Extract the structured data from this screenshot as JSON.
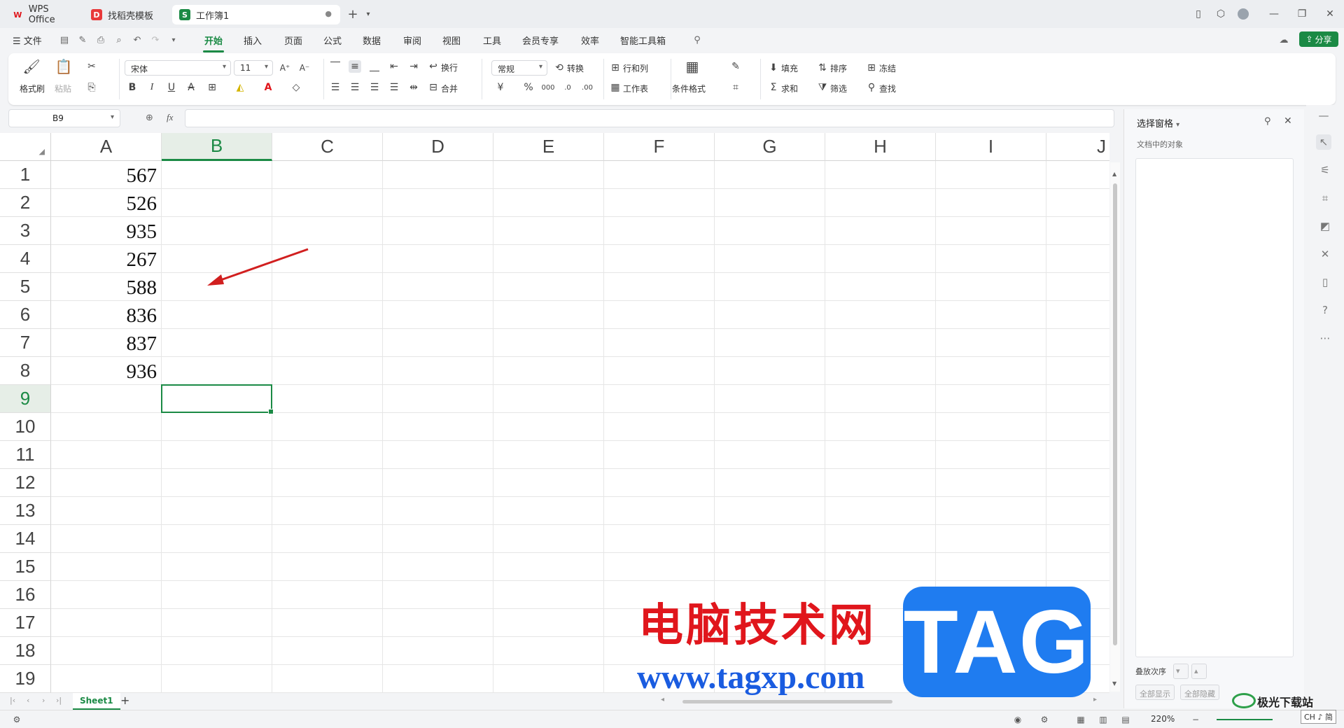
{
  "titlebar": {
    "tabs": [
      {
        "label": "WPS Office",
        "icon": "wps-logo-icon",
        "color": "#e0161c"
      },
      {
        "label": "找稻壳模板",
        "icon": "docer-icon",
        "color": "#e8393a"
      },
      {
        "label": "工作簿1",
        "icon": "spreadsheet-icon",
        "color": "#1b8a45"
      }
    ],
    "new_tab": "+"
  },
  "menubar": {
    "file": "文件",
    "items": [
      "开始",
      "插入",
      "页面",
      "公式",
      "数据",
      "审阅",
      "视图",
      "工具",
      "会员专享",
      "效率",
      "智能工具箱"
    ],
    "active": "开始",
    "share": "分享"
  },
  "ribbon": {
    "format_painter": "格式刷",
    "paste": "粘贴",
    "font_name": "宋体",
    "font_size": "11",
    "wrap": "换行",
    "merge": "合并",
    "number_format": "常规",
    "convert": "转换",
    "row_col": "行和列",
    "worksheet": "工作表",
    "cond_format": "条件格式",
    "fill": "填充",
    "sort": "排序",
    "freeze": "冻结",
    "sum": "求和",
    "filter": "筛选",
    "find": "查找",
    "bold": "B",
    "italic": "I",
    "underline": "U",
    "strike": "A",
    "currency": "¥",
    "percent": "%"
  },
  "formula_bar": {
    "name_box": "B9",
    "fx": "fx",
    "value": ""
  },
  "sheet": {
    "columns": [
      "A",
      "B",
      "C",
      "D",
      "E",
      "F",
      "G",
      "H",
      "I",
      "J"
    ],
    "rows": [
      "1",
      "2",
      "3",
      "4",
      "5",
      "6",
      "7",
      "8",
      "9",
      "10",
      "11",
      "12",
      "13",
      "14",
      "15",
      "16",
      "17",
      "18",
      "19"
    ],
    "col_a_values": [
      "567",
      "526",
      "935",
      "267",
      "588",
      "836",
      "837",
      "936"
    ],
    "selected_cell": "B9",
    "accent": "#1b8a45"
  },
  "sheet_tabs": {
    "active": "Sheet1",
    "add": "+"
  },
  "statusbar": {
    "zoom": "220%"
  },
  "right_pane": {
    "title": "选择窗格",
    "subtitle": "文档中的对象",
    "order_label": "叠放次序",
    "show_all": "全部显示",
    "hide_all": "全部隐藏"
  },
  "watermark": {
    "text": "电脑技术网",
    "url": "www.tagxp.com",
    "tag": "TAG",
    "badge": "极光下载站",
    "ime": "CH ♪ 简"
  }
}
